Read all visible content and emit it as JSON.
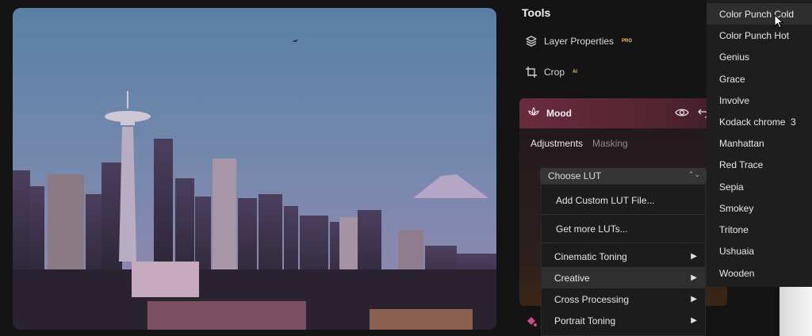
{
  "tools": {
    "title": "Tools",
    "layer_properties": {
      "label": "Layer Properties",
      "badge": "PRO"
    },
    "crop": {
      "label": "Crop",
      "badge": "AI"
    },
    "mood": {
      "title": "Mood",
      "tabs": {
        "adjustments": "Adjustments",
        "masking": "Masking"
      },
      "lut_select": "Choose LUT"
    }
  },
  "lut_menu": {
    "items": [
      {
        "label": "Add Custom LUT File..."
      },
      {
        "label": "Get more LUTs..."
      },
      {
        "label": "Cinematic Toning"
      },
      {
        "label": "Creative"
      },
      {
        "label": "Cross Processing"
      },
      {
        "label": "Portrait Toning"
      }
    ]
  },
  "submenu": {
    "items": [
      {
        "label": "Color Punch Cold"
      },
      {
        "label": "Color Punch Hot"
      },
      {
        "label": "Genius"
      },
      {
        "label": "Grace"
      },
      {
        "label": "Involve"
      },
      {
        "label": "Kodack chrome  3"
      },
      {
        "label": "Manhattan"
      },
      {
        "label": "Red Trace"
      },
      {
        "label": "Sepia"
      },
      {
        "label": "Smokey"
      },
      {
        "label": "Tritone"
      },
      {
        "label": "Ushuaia"
      },
      {
        "label": "Wooden"
      }
    ]
  },
  "colors": {
    "mood_accent": "#6a2a3e",
    "badge": "#e6c15b",
    "menu_bg": "#1c1c1c"
  }
}
